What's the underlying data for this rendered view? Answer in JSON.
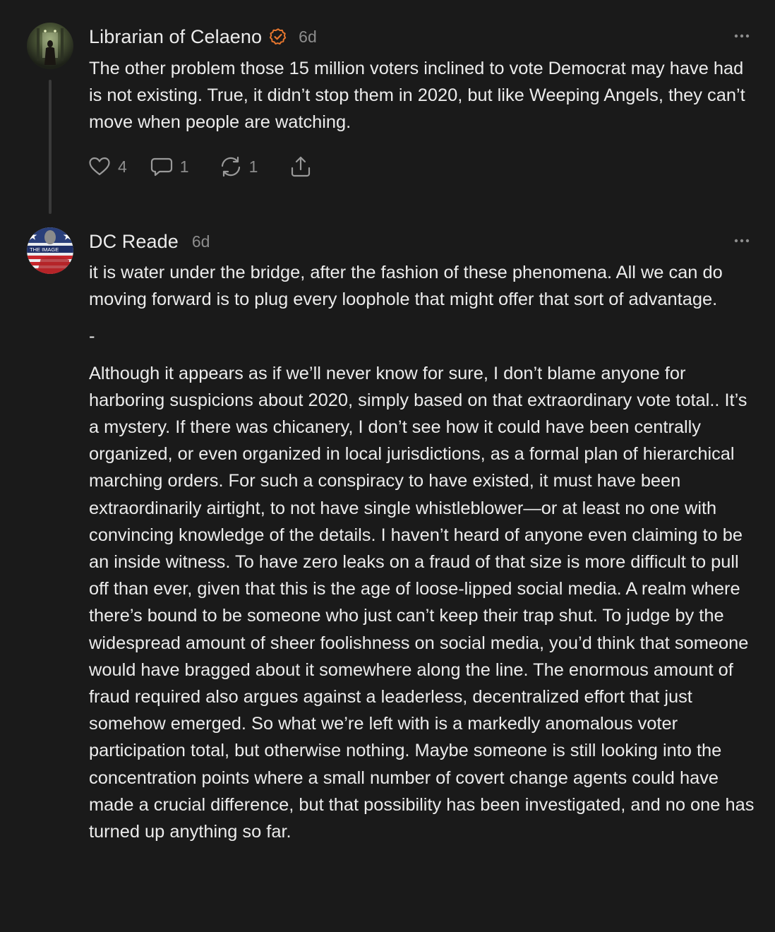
{
  "comments": [
    {
      "author": "Librarian of Celaeno",
      "verified": true,
      "time": "6d",
      "paragraphs": [
        "The other problem those 15 million voters inclined to vote Democrat may have had is not existing. True, it didn’t stop them in 2020, but like Weeping Angels, they can’t move when people are watching."
      ],
      "actions": {
        "likes": "4",
        "replies": "1",
        "restacks": "1"
      },
      "icons": {
        "like": "heart-icon",
        "reply": "comment-bubble-icon",
        "restack": "restack-icon",
        "share": "share-icon",
        "more": "ellipsis-icon",
        "verified": "verified-badge-icon"
      }
    },
    {
      "author": "DC Reade",
      "time": "6d",
      "avatar_text": "THE IMAGE",
      "paragraphs": [
        "it is water under the bridge, after the fashion of these phenomena. All we can do moving forward is to plug every loophole that might offer that sort of advantage.",
        "-",
        "Although it appears as if we’ll never know for sure, I don’t blame anyone for harboring suspicions about 2020, simply based on that extraordinary vote total.. It’s a mystery. If there was chicanery, I don’t see how it could have been centrally organized, or even organized in local jurisdictions, as a formal plan of hierarchical marching orders. For such a conspiracy to have existed, it must have been extraordinarily airtight, to not have single whistleblower—or at least no one with convincing knowledge of the details. I haven’t heard of anyone even claiming to be an inside witness. To have zero leaks on a fraud of that size is more difficult to pull off than ever, given that this is the age of loose-lipped social media. A realm where there’s bound to be someone who just can’t keep their trap shut. To judge by the widespread amount of sheer foolishness on social media, you’d think that someone would have bragged about it somewhere along the line. The enormous amount of fraud required also argues against a leaderless, decentralized effort that just somehow emerged. So what we’re left with is a markedly anomalous voter participation total, but otherwise nothing. Maybe someone is still looking into the concentration points where a small number of covert change agents could have made a crucial difference, but that possibility has been investigated, and no one has turned up anything so far."
      ],
      "icons": {
        "more": "ellipsis-icon"
      }
    }
  ],
  "colors": {
    "background": "#1a1a1a",
    "text": "#ececec",
    "muted": "#8d8d8d",
    "verified": "#e8772e",
    "thread_line": "#3a3a3a"
  }
}
